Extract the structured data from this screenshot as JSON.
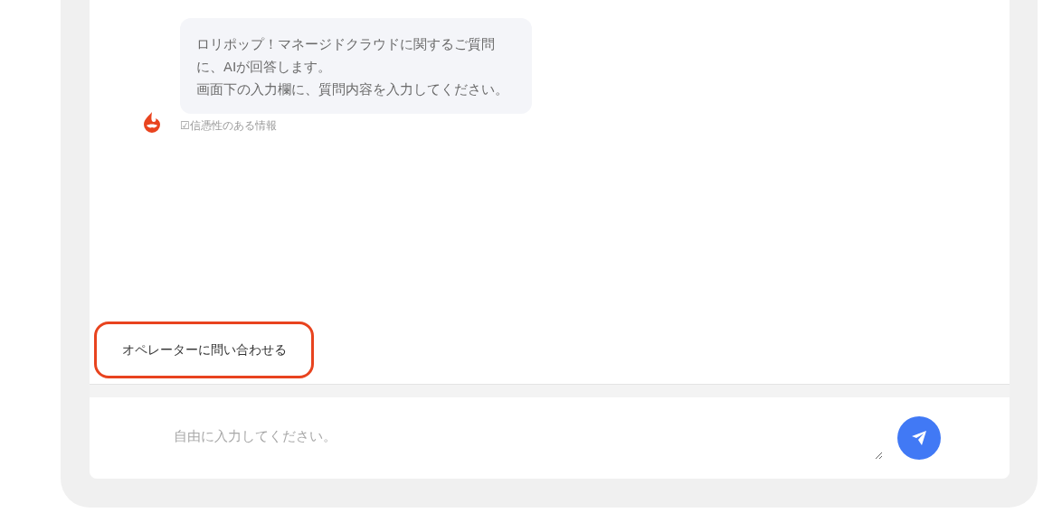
{
  "messages": [
    {
      "lines": [
        "ロリポップ！マネージドクラウドに関するご質問",
        "に、AIが回答します。",
        "画面下の入力欄に、質問内容を入力してください。"
      ],
      "caption": "☑信憑性のある情報"
    }
  ],
  "operator_button": {
    "label": "オペレーターに問い合わせる",
    "highlighted": true
  },
  "input": {
    "placeholder": "自由に入力してください。"
  }
}
